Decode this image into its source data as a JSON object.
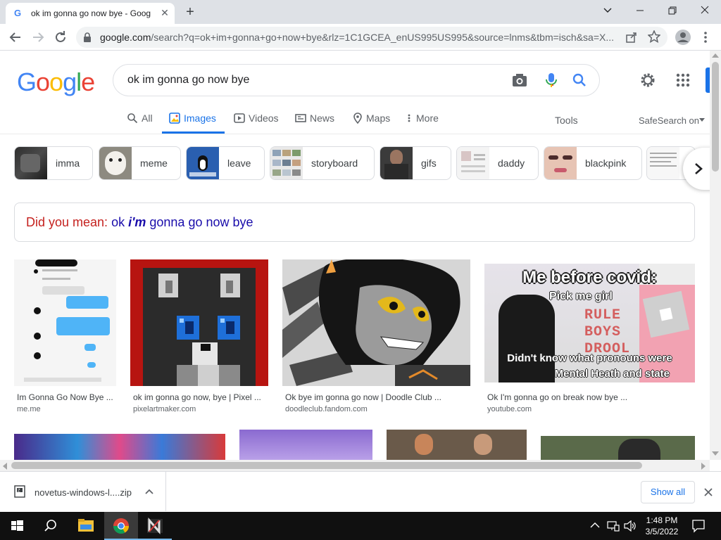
{
  "browser": {
    "tab_title": "ok im gonna go now bye - Goog",
    "tab_favicon": "G",
    "url_host": "google.com",
    "url_rest": "/search?q=ok+im+gonna+go+now+bye&rlz=1C1GCEA_enUS995US995&source=lnms&tbm=isch&sa=X..."
  },
  "google": {
    "logo_letters": [
      "G",
      "o",
      "o",
      "g",
      "l",
      "e"
    ],
    "logo_colors": [
      "#4285f4",
      "#ea4335",
      "#fbbc05",
      "#4285f4",
      "#34a853",
      "#ea4335"
    ],
    "query": "ok im gonna go now bye",
    "nav": [
      {
        "label": "All"
      },
      {
        "label": "Images",
        "active": true
      },
      {
        "label": "Videos"
      },
      {
        "label": "News"
      },
      {
        "label": "Maps"
      },
      {
        "label": "More"
      }
    ],
    "tools": "Tools",
    "safesearch": "SafeSearch on",
    "chips": [
      "imma",
      "meme",
      "leave",
      "storyboard",
      "gifs",
      "daddy",
      "blackpink"
    ],
    "did_you_mean": {
      "prefix": "Did you mean:",
      "pre": "ok ",
      "bold": "i'm",
      "post": " gonna go now bye"
    },
    "results": [
      {
        "title": "Im Gonna Go Now Bye ...",
        "source": "me.me"
      },
      {
        "title": "ok im gonna go now, bye | Pixel ...",
        "source": "pixelartmaker.com"
      },
      {
        "title": "Ok bye im gonna go now | Doodle Club ...",
        "source": "doodleclub.fandom.com"
      },
      {
        "title": "Ok I'm gonna go on break now bye ...",
        "source": "youtube.com"
      }
    ],
    "meme_text": {
      "headline": "Me before covid:",
      "pick": "Pick me girl",
      "letters": [
        "RULE",
        "BOYS",
        "DROOL"
      ],
      "bottom1": "Didn't know what pronouns were",
      "bottom2": "Mental Heath and state"
    },
    "accent_color": "#1a73e8"
  },
  "downloads": {
    "file": "novetus-windows-l....zip",
    "show_all": "Show all"
  },
  "taskbar": {
    "time": "1:48 PM",
    "date": "3/5/2022"
  }
}
